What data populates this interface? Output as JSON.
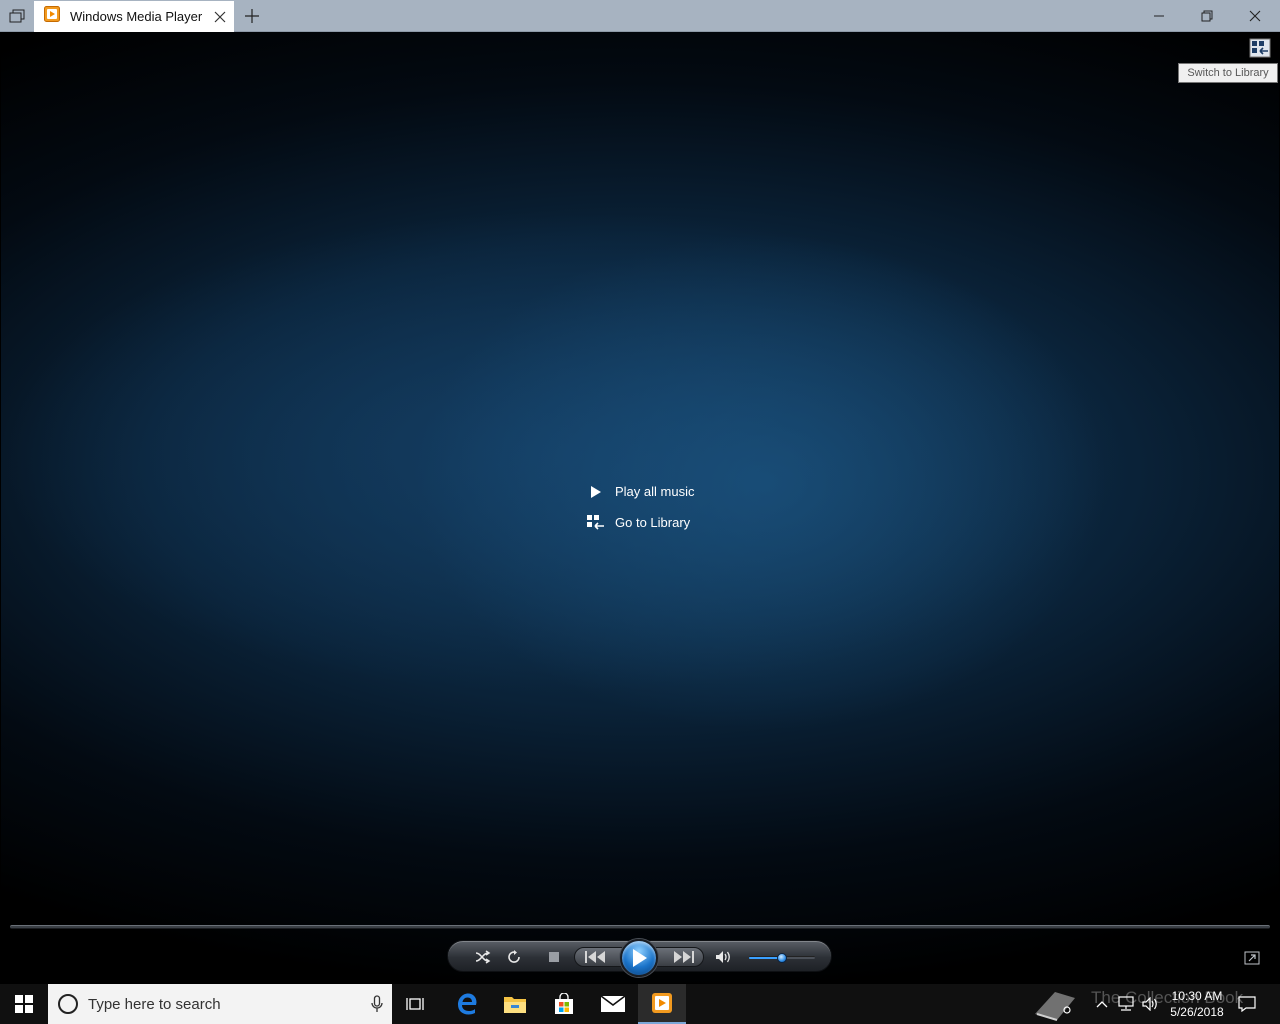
{
  "window": {
    "tab_title": "Windows Media Player"
  },
  "player": {
    "tooltip": "Switch to Library",
    "menu": [
      {
        "label": "Play all music"
      },
      {
        "label": "Go to Library"
      }
    ],
    "volume_level": 0.5
  },
  "taskbar": {
    "search_placeholder": "Type here to search",
    "watermark": "The Collection Book",
    "clock_time": "10:30 AM",
    "clock_date": "5/26/2018"
  },
  "colors": {
    "accent_blue": "#2f8de6",
    "taskbar_bg": "#101010",
    "titlebar_bg": "#a7b3c1"
  }
}
